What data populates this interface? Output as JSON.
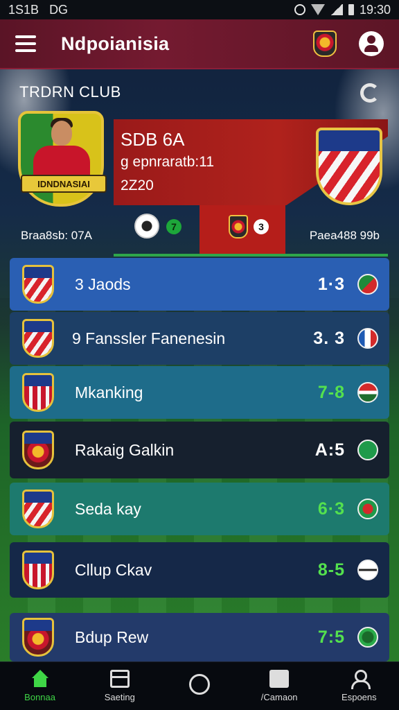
{
  "status_bar": {
    "left_text": "1S1B",
    "left_text2": "DG",
    "time": "19:30"
  },
  "app_bar": {
    "title": "Ndpoianisia",
    "icons": [
      "menu-icon",
      "club-crest-icon",
      "profile-icon"
    ]
  },
  "featured": {
    "title": "TRDRN CLUB",
    "badge_text": "IDNDNASIAI",
    "score_title": "SDB 6A",
    "score_sub": "g epnraratb:11",
    "score_year": "2Z20",
    "home_goals_badge": "7",
    "away_goals_badge": "3",
    "left_label": "Braa8sb: 07A",
    "right_label": "Paea488 99b",
    "colors": {
      "panel_red": "#b0221c",
      "accent_green": "#2ea64a"
    }
  },
  "matches": [
    {
      "name": "3 Jaods",
      "score": "1·3",
      "score_color": "white",
      "bg": "#2a5fb3",
      "flag": "f1"
    },
    {
      "name": "9 Fanssler Fanenesin",
      "score": "3. 3",
      "score_color": "white",
      "bg": "#1d3f66",
      "flag": "f2"
    },
    {
      "name": "Mkanking",
      "score": "7-8",
      "score_color": "green",
      "bg": "#1e6c8a",
      "flag": "f3"
    },
    {
      "name": "Rakaig Galkin",
      "score": "A:5",
      "score_color": "white",
      "bg": "#16202e",
      "flag": "f4"
    },
    {
      "name": "Seda kay",
      "score": "6·3",
      "score_color": "green",
      "bg": "#1d7a6e",
      "flag": "f5"
    },
    {
      "name": "Cllup Ckav",
      "score": "8-5",
      "score_color": "green",
      "bg": "#152848",
      "flag": "f6"
    },
    {
      "name": "Bdup Rew",
      "score": "7:5",
      "score_color": "green",
      "bg": "#233a6a",
      "flag": "f7"
    }
  ],
  "bottom_nav": [
    {
      "label": "Bonnaa",
      "icon": "home-icon",
      "active": true
    },
    {
      "label": "Saeting",
      "icon": "list-icon",
      "active": false
    },
    {
      "label": "",
      "icon": "circle-icon",
      "active": false
    },
    {
      "label": "/Camaon",
      "icon": "chat-icon",
      "active": false
    },
    {
      "label": "Espoens",
      "icon": "user-icon",
      "active": false
    }
  ]
}
